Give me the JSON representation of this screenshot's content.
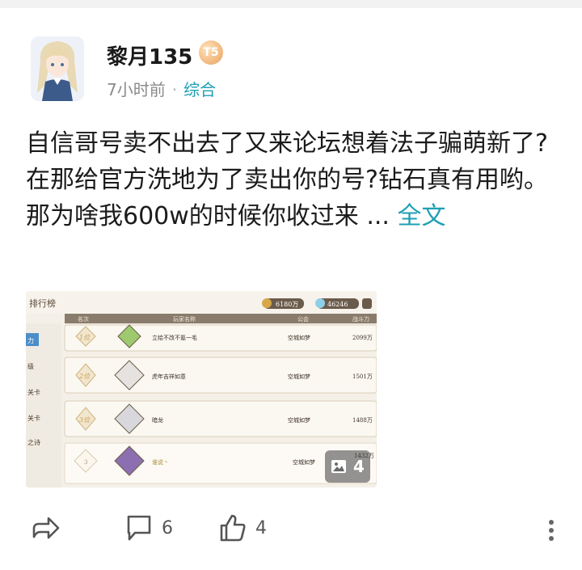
{
  "post": {
    "author": {
      "name": "黎月135",
      "level_badge": "T5"
    },
    "time": "7小时前",
    "separator": "·",
    "category": "综合",
    "body_lines": [
      "自信哥号卖不出去了又来论坛想着法子骗萌新了?",
      "在那给官方洗地为了卖出你的号?钻石真有用哟。那为啥我600w的时候你收过来 ..."
    ],
    "full_text_link": "全文",
    "image_count": "4"
  },
  "actions": {
    "share_icon": "share-icon",
    "comment_count": "6",
    "like_count": "4",
    "more_icon": "more-vertical-icon"
  },
  "screenshot": {
    "title": "排行榜",
    "currency_gold": "6180万",
    "currency_diamond": "46246",
    "columns": [
      "名次",
      "玩家名称",
      "公会",
      "战斗力"
    ],
    "side_tabs": [
      "力",
      "级",
      "关卡",
      "关卡",
      "之诗"
    ],
    "rows": [
      {
        "rank": "1位",
        "name": "立绘不改不氪一毛",
        "guild": "空城如梦",
        "power": "2099万"
      },
      {
        "rank": "2位",
        "name": "虎年吉祥如意",
        "guild": "空城如梦",
        "power": "1501万"
      },
      {
        "rank": "3位",
        "name": "暗龙",
        "guild": "空城如梦",
        "power": "1488万"
      },
      {
        "rank": "3",
        "name": "谁说丶",
        "guild": "空城如梦",
        "power": "1432万"
      }
    ]
  },
  "colors": {
    "accent": "#1e9fb3",
    "badge": "#e8a25f",
    "text": "#1b1b1b",
    "muted": "#8a8a8a"
  }
}
